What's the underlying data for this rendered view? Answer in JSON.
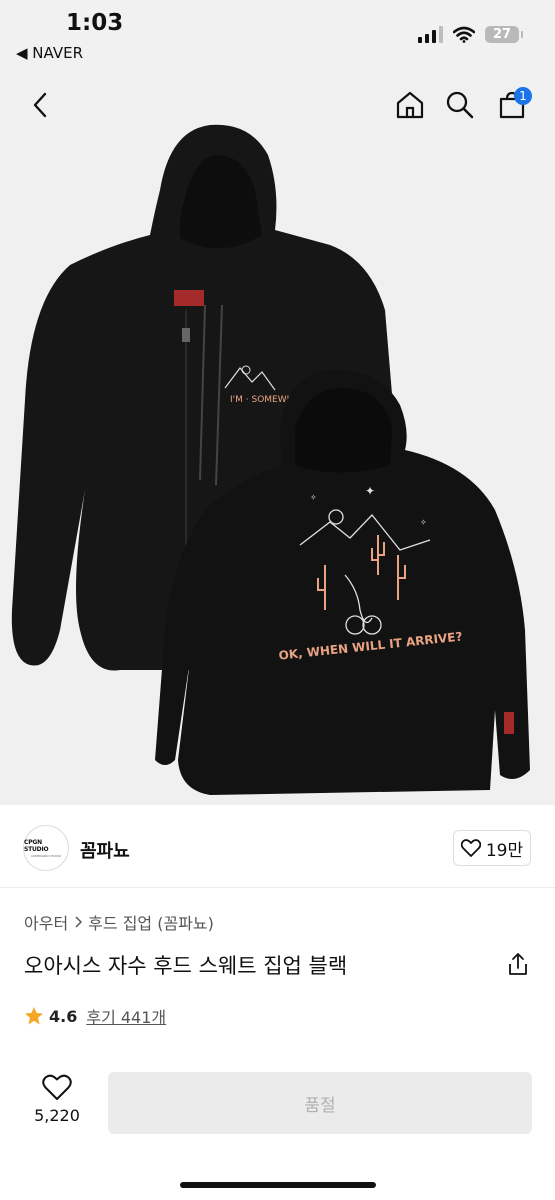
{
  "status_bar": {
    "time": "1:03",
    "back_app": "◀ NAVER",
    "battery": "27"
  },
  "nav": {
    "cart_badge": "1"
  },
  "product_image": {
    "front_chest_text": "I'M · SOMEWHERE",
    "back_print_text": "OK, WHEN WILL IT ARRIVE?"
  },
  "seller": {
    "logo_text": "CPGN STUDIO",
    "logo_subtext": "COMPAGNO STUDIO",
    "name": "꼼파뇨",
    "likes": "19만"
  },
  "breadcrumb": [
    "아우터",
    "후드 집업 (꼼파뇨)"
  ],
  "product": {
    "title": "오아시스 자수 후드 스웨트 집업 블랙",
    "rating": "4.6",
    "review_link": "후기 441개"
  },
  "bottom": {
    "wish_count": "5,220",
    "soldout_label": "품절"
  },
  "colors": {
    "accent": "#1a73e8",
    "star": "#f5a623",
    "hoodie": "#151515",
    "embroidery": "#e9a383"
  },
  "icons": [
    "back-arrow-icon",
    "home-icon",
    "search-icon",
    "cart-icon",
    "heart-icon",
    "share-icon",
    "star-icon",
    "chevron-right-icon"
  ]
}
